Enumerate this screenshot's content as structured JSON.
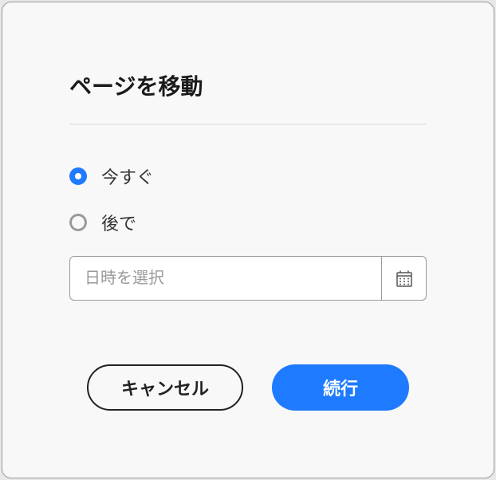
{
  "dialog": {
    "title": "ページを移動",
    "options": {
      "now": "今すぐ",
      "later": "後で"
    },
    "datetime": {
      "placeholder": "日時を選択"
    },
    "buttons": {
      "cancel": "キャンセル",
      "continue": "続行"
    }
  },
  "colors": {
    "accent": "#1e7bff"
  }
}
